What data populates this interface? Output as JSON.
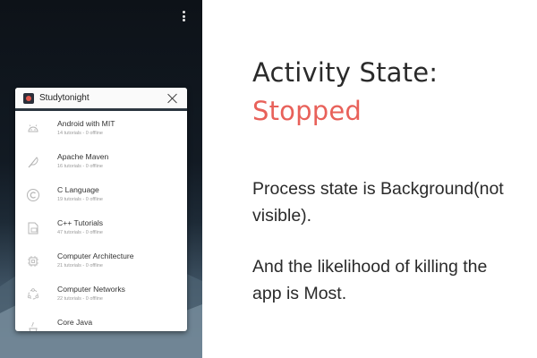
{
  "recents_card": {
    "app_title": "Studytonight",
    "items": [
      {
        "title": "Android with MIT",
        "subtitle": "14 tutorials - 0 offline",
        "icon": "android-head-icon"
      },
      {
        "title": "Apache Maven",
        "subtitle": "16 tutorials - 0 offline",
        "icon": "feather-icon"
      },
      {
        "title": "C Language",
        "subtitle": "19 tutorials - 0 offline",
        "icon": "c-letter-icon"
      },
      {
        "title": "C++ Tutorials",
        "subtitle": "47 tutorials - 0 offline",
        "icon": "cpp-file-icon"
      },
      {
        "title": "Computer Architecture",
        "subtitle": "21 tutorials - 0 offline",
        "icon": "chip-icon"
      },
      {
        "title": "Computer Networks",
        "subtitle": "22 tutorials - 0 offline",
        "icon": "network-icon"
      },
      {
        "title": "Core Java",
        "subtitle": "",
        "icon": "java-icon"
      }
    ]
  },
  "slide": {
    "heading": "Activity State:",
    "state": "Stopped",
    "paragraph1": "Process state is Background(not visible).",
    "paragraph2": "And the likelihood of killing the app is Most."
  },
  "colors": {
    "state_accent": "#e8615a",
    "text": "#2a2a2a"
  }
}
